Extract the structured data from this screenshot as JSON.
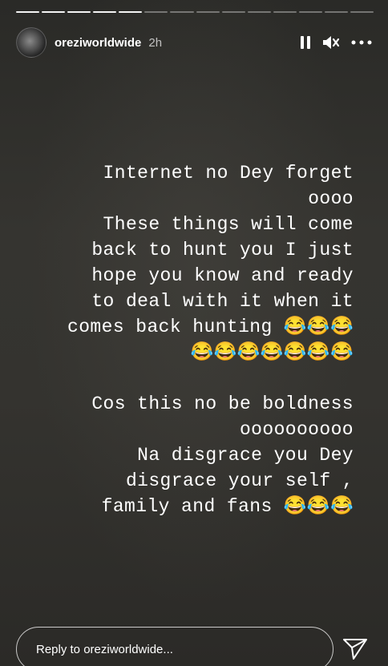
{
  "progress": {
    "total_segments": 14,
    "completed_segments": 5
  },
  "header": {
    "username": "oreziworldwide",
    "timestamp": "2h",
    "icons": [
      "avatar",
      "pause-icon",
      "mute-icon",
      "more-options-icon"
    ]
  },
  "story": {
    "paragraph_1": "Internet no Dey forget\noooo\nThese things will come\nback to hunt you I just\nhope you know and ready\nto deal with it when it\ncomes back hunting 😂😂😂\n😂😂😂😂😂😂😂",
    "paragraph_2": "Cos this no be boldness\noooooooooo\nNa disgrace you Dey\ndisgrace your self ,\nfamily and fans 😂😂😂"
  },
  "reply": {
    "placeholder": "Reply to oreziworldwide...",
    "send_icon": "send-icon"
  }
}
